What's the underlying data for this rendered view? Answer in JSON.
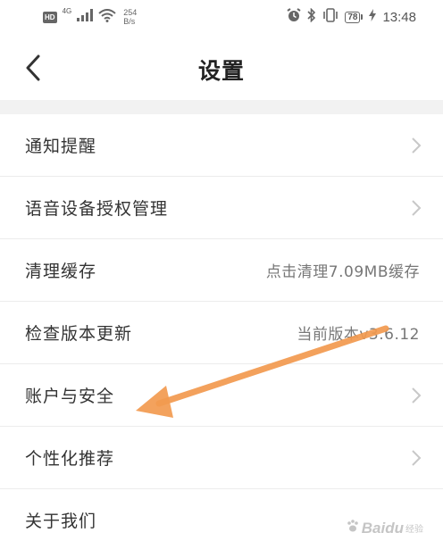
{
  "status_bar": {
    "hd_badge": "HD",
    "network_type": "4G",
    "speed_value": "254",
    "speed_unit": "B/s",
    "battery_level": "78",
    "time": "13:48"
  },
  "header": {
    "title": "设置"
  },
  "settings": [
    {
      "label": "通知提醒",
      "value": "",
      "has_chevron": true
    },
    {
      "label": "语音设备授权管理",
      "value": "",
      "has_chevron": true
    },
    {
      "label": "清理缓存",
      "value": "点击清理7.09MB缓存",
      "has_chevron": false
    },
    {
      "label": "检查版本更新",
      "value": "当前版本v3.6.12",
      "has_chevron": false
    },
    {
      "label": "账户与安全",
      "value": "",
      "has_chevron": true
    },
    {
      "label": "个性化推荐",
      "value": "",
      "has_chevron": true
    },
    {
      "label": "关于我们",
      "value": "",
      "has_chevron": false
    }
  ],
  "annotation": {
    "type": "arrow",
    "color": "#f29a4f",
    "points_to": "账户与安全"
  },
  "watermark": {
    "text": "Baidu",
    "sub": "经验"
  }
}
